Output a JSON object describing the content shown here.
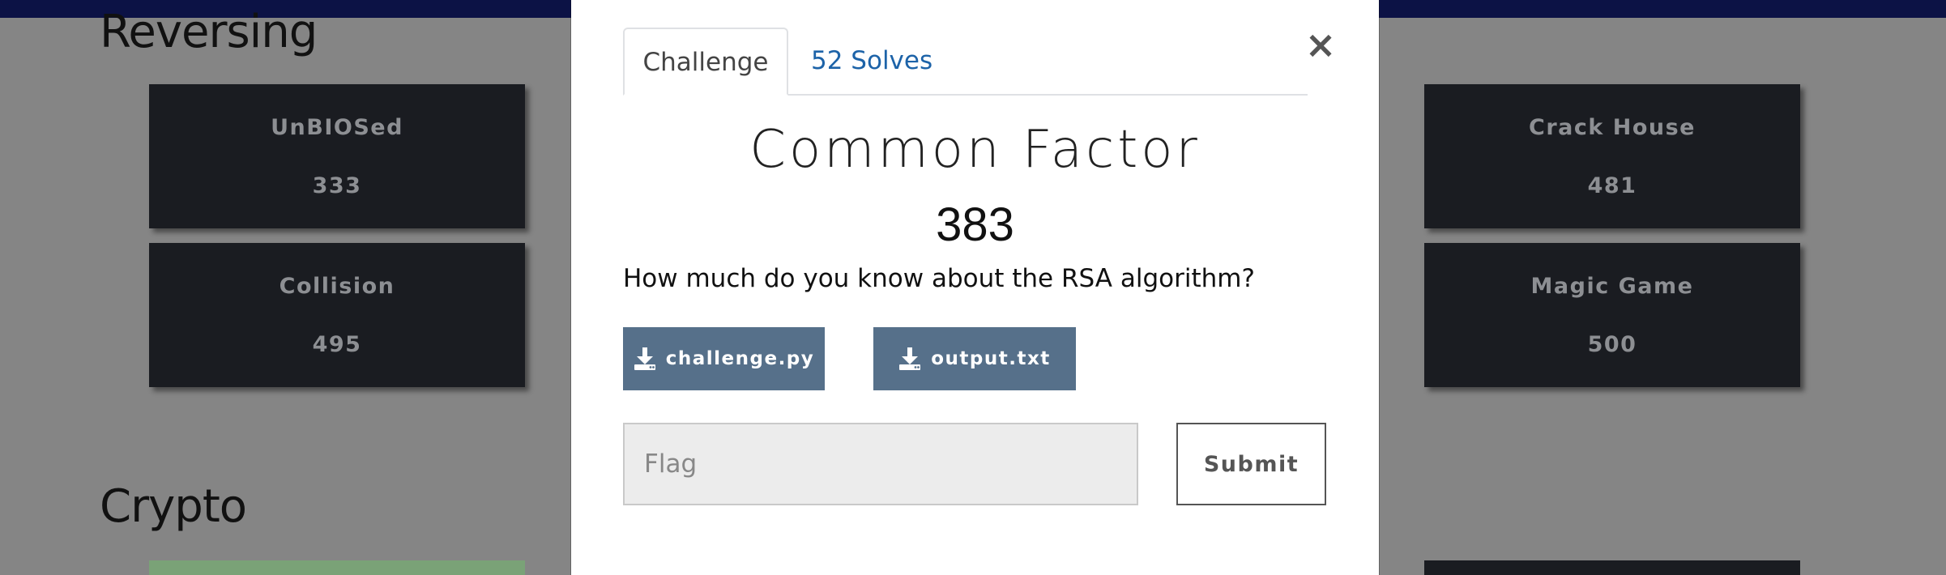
{
  "sections": {
    "reversing": "Reversing",
    "crypto": "Crypto"
  },
  "cards": [
    {
      "name": "UnBIOSed",
      "points": "333"
    },
    {
      "name": "Collision",
      "points": "495"
    },
    {
      "name": "Crack House",
      "points": "481"
    },
    {
      "name": "Magic Game",
      "points": "500"
    }
  ],
  "modal": {
    "tabs": {
      "challenge": "Challenge",
      "solves": "52 Solves"
    },
    "close": "×",
    "title": "Common Factor",
    "points": "383",
    "description": "How much do you know about the RSA algorithm?",
    "files": [
      "challenge.py",
      "output.txt"
    ],
    "flag_placeholder": "Flag",
    "submit": "Submit"
  },
  "colors": {
    "backdrop": "#858585",
    "navbar": "#0c1245",
    "card": "#1a1c21",
    "solved_card": "#7aa277",
    "file_button": "#56708a",
    "link": "#1d63a8"
  },
  "icons": {
    "file_button": "download-icon",
    "close": "close-icon"
  }
}
